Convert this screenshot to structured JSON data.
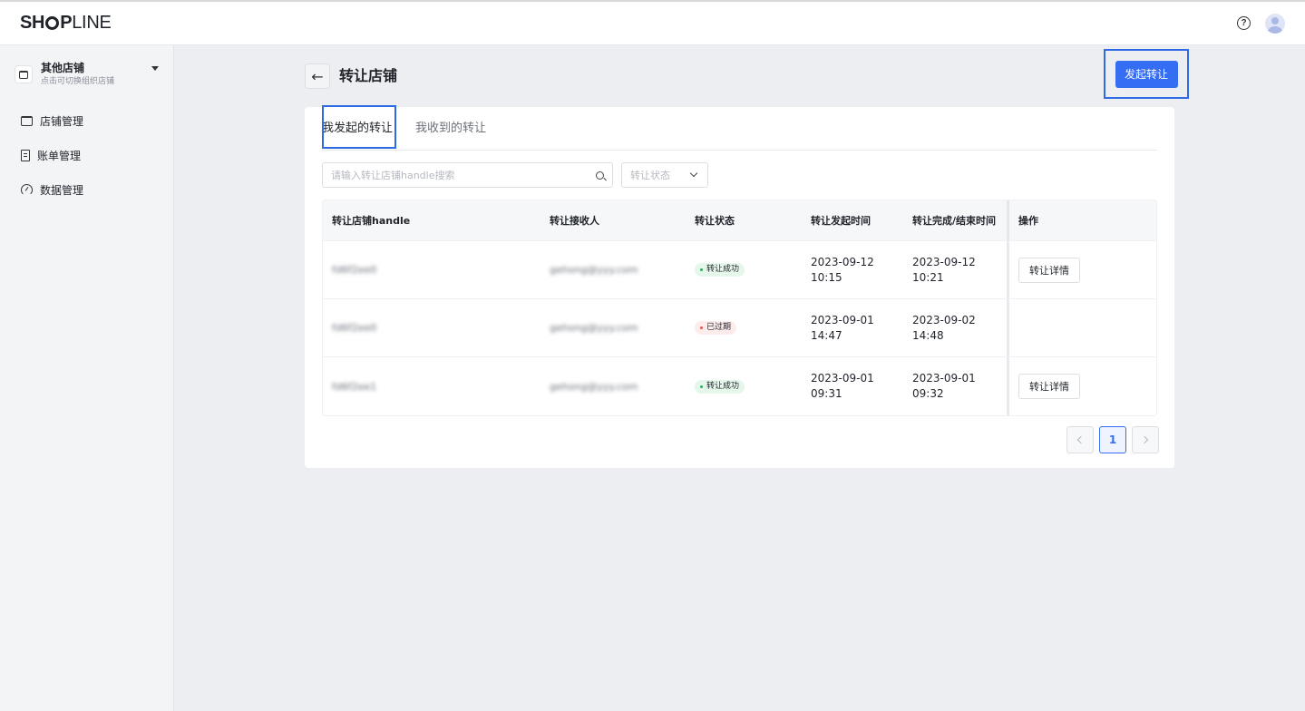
{
  "brand": {
    "logo_text_bold_1": "SH",
    "logo_text_bold_2": "P",
    "logo_text_thin": "LINE"
  },
  "header": {
    "help_glyph": "?"
  },
  "sidebar": {
    "store_name": "其他店铺",
    "store_hint": "点击可切换组织店铺",
    "items": [
      {
        "label": "店铺管理",
        "icon": "store-icon"
      },
      {
        "label": "账单管理",
        "icon": "bill-icon"
      },
      {
        "label": "数据管理",
        "icon": "dashboard-icon"
      }
    ]
  },
  "page": {
    "title": "转让店铺",
    "primary_button": "发起转让",
    "back_glyph": "←"
  },
  "tabs": [
    {
      "label": "我发起的转让",
      "active": true
    },
    {
      "label": "我收到的转让",
      "active": false
    }
  ],
  "filters": {
    "search_placeholder": "请输入转让店铺handle搜索",
    "status_placeholder": "转让状态"
  },
  "table": {
    "columns": [
      "转让店铺handle",
      "转让接收人",
      "转让状态",
      "转让发起时间",
      "转让完成/结束时间",
      "操作"
    ],
    "rows": [
      {
        "handle": "fd6f2ee0",
        "recipient": "gehong@yyy.com",
        "status": "转让成功",
        "status_type": "success",
        "start_date": "2023-09-12",
        "start_time": "10:15",
        "end": "2023-09-12 10:21",
        "action": "转让详情"
      },
      {
        "handle": "fd6f2ee0",
        "recipient": "gehong@yyy.com",
        "status": "已过期",
        "status_type": "expired",
        "start_date": "2023-09-01",
        "start_time": "14:47",
        "end": "2023-09-02 14:48",
        "action": ""
      },
      {
        "handle": "fd6f2ee1",
        "recipient": "gehong@yyy.com",
        "status": "转让成功",
        "status_type": "success",
        "start_date": "2023-09-01",
        "start_time": "09:31",
        "end": "2023-09-01 09:32",
        "action": "转让详情"
      }
    ]
  },
  "pagination": {
    "current": "1"
  },
  "colors": {
    "primary": "#356df3",
    "highlight": "#2f6ae5",
    "success": "#23b05c",
    "danger": "#e5534b"
  }
}
